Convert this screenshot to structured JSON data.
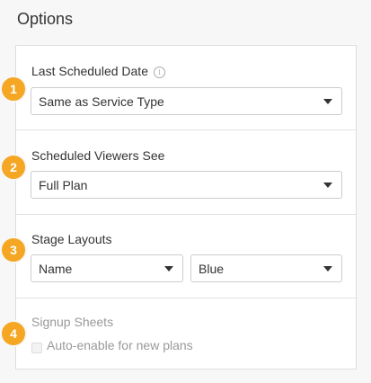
{
  "page": {
    "title": "Options"
  },
  "sections": [
    {
      "number": "1",
      "label": "Last Scheduled Date",
      "info_icon": "info-icon",
      "select": {
        "value": "Same as Service Type"
      }
    },
    {
      "number": "2",
      "label": "Scheduled Viewers See",
      "select": {
        "value": "Full Plan"
      }
    },
    {
      "number": "3",
      "label": "Stage Layouts",
      "select_left": {
        "value": "Name"
      },
      "select_right": {
        "value": "Blue"
      }
    },
    {
      "number": "4",
      "label": "Signup Sheets",
      "checkbox": {
        "label": "Auto-enable for new plans",
        "checked": false,
        "disabled": true
      }
    }
  ],
  "colors": {
    "badge": "#f5a623",
    "muted_text": "#999999",
    "border": "#dddddd"
  }
}
